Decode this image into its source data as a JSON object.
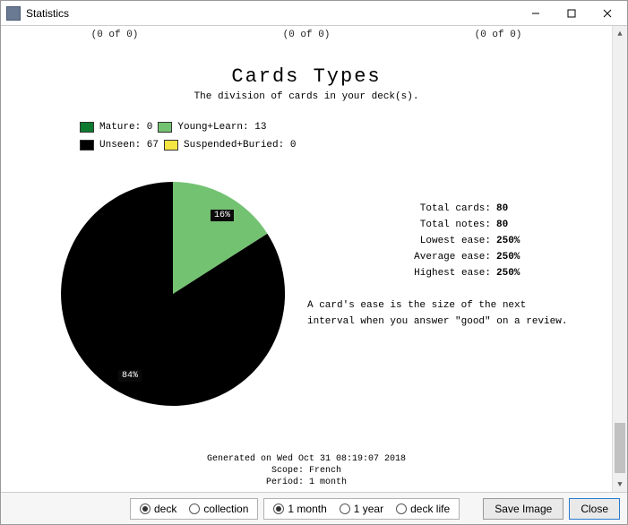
{
  "window": {
    "title": "Statistics"
  },
  "toprow": {
    "a": "(0 of 0)",
    "b": "(0 of 0)",
    "c": "(0 of 0)"
  },
  "heading": {
    "title": "Cards Types",
    "subtitle": "The division of cards in your deck(s)."
  },
  "legend": {
    "mature": {
      "label": "Mature: 0",
      "color": "#0e7a2f"
    },
    "young": {
      "label": "Young+Learn: 13",
      "color": "#73c272"
    },
    "unseen": {
      "label": "Unseen: 67",
      "color": "#000000"
    },
    "suspended": {
      "label": "Suspended+Buried: 0",
      "color": "#f4e542"
    }
  },
  "chart_data": {
    "type": "pie",
    "title": "Cards Types",
    "series": [
      {
        "name": "Mature",
        "value": 0,
        "percent": 0,
        "color": "#0e7a2f"
      },
      {
        "name": "Young+Learn",
        "value": 13,
        "percent": 16,
        "color": "#73c272"
      },
      {
        "name": "Unseen",
        "value": 67,
        "percent": 84,
        "color": "#000000"
      },
      {
        "name": "Suspended+Buried",
        "value": 0,
        "percent": 0,
        "color": "#f4e542"
      }
    ],
    "slice_labels": {
      "young": "16%",
      "unseen": "84%"
    }
  },
  "stats": {
    "total_cards": {
      "k": "Total cards:",
      "v": "80"
    },
    "total_notes": {
      "k": "Total notes:",
      "v": "80"
    },
    "lowest_ease": {
      "k": "Lowest ease:",
      "v": "250%"
    },
    "average_ease": {
      "k": "Average ease:",
      "v": "250%"
    },
    "highest_ease": {
      "k": "Highest ease:",
      "v": "250%"
    },
    "note": "A card's ease is the size of the next interval when you answer \"good\" on a review."
  },
  "footer_gen": {
    "line1": "Generated on Wed Oct 31 08:19:07 2018",
    "line2": "Scope: French",
    "line3": "Period: 1 month"
  },
  "bottom": {
    "group1": {
      "deck": "deck",
      "collection": "collection"
    },
    "group2": {
      "m1": "1 month",
      "y1": "1 year",
      "life": "deck life"
    },
    "save": "Save Image",
    "close": "Close"
  }
}
